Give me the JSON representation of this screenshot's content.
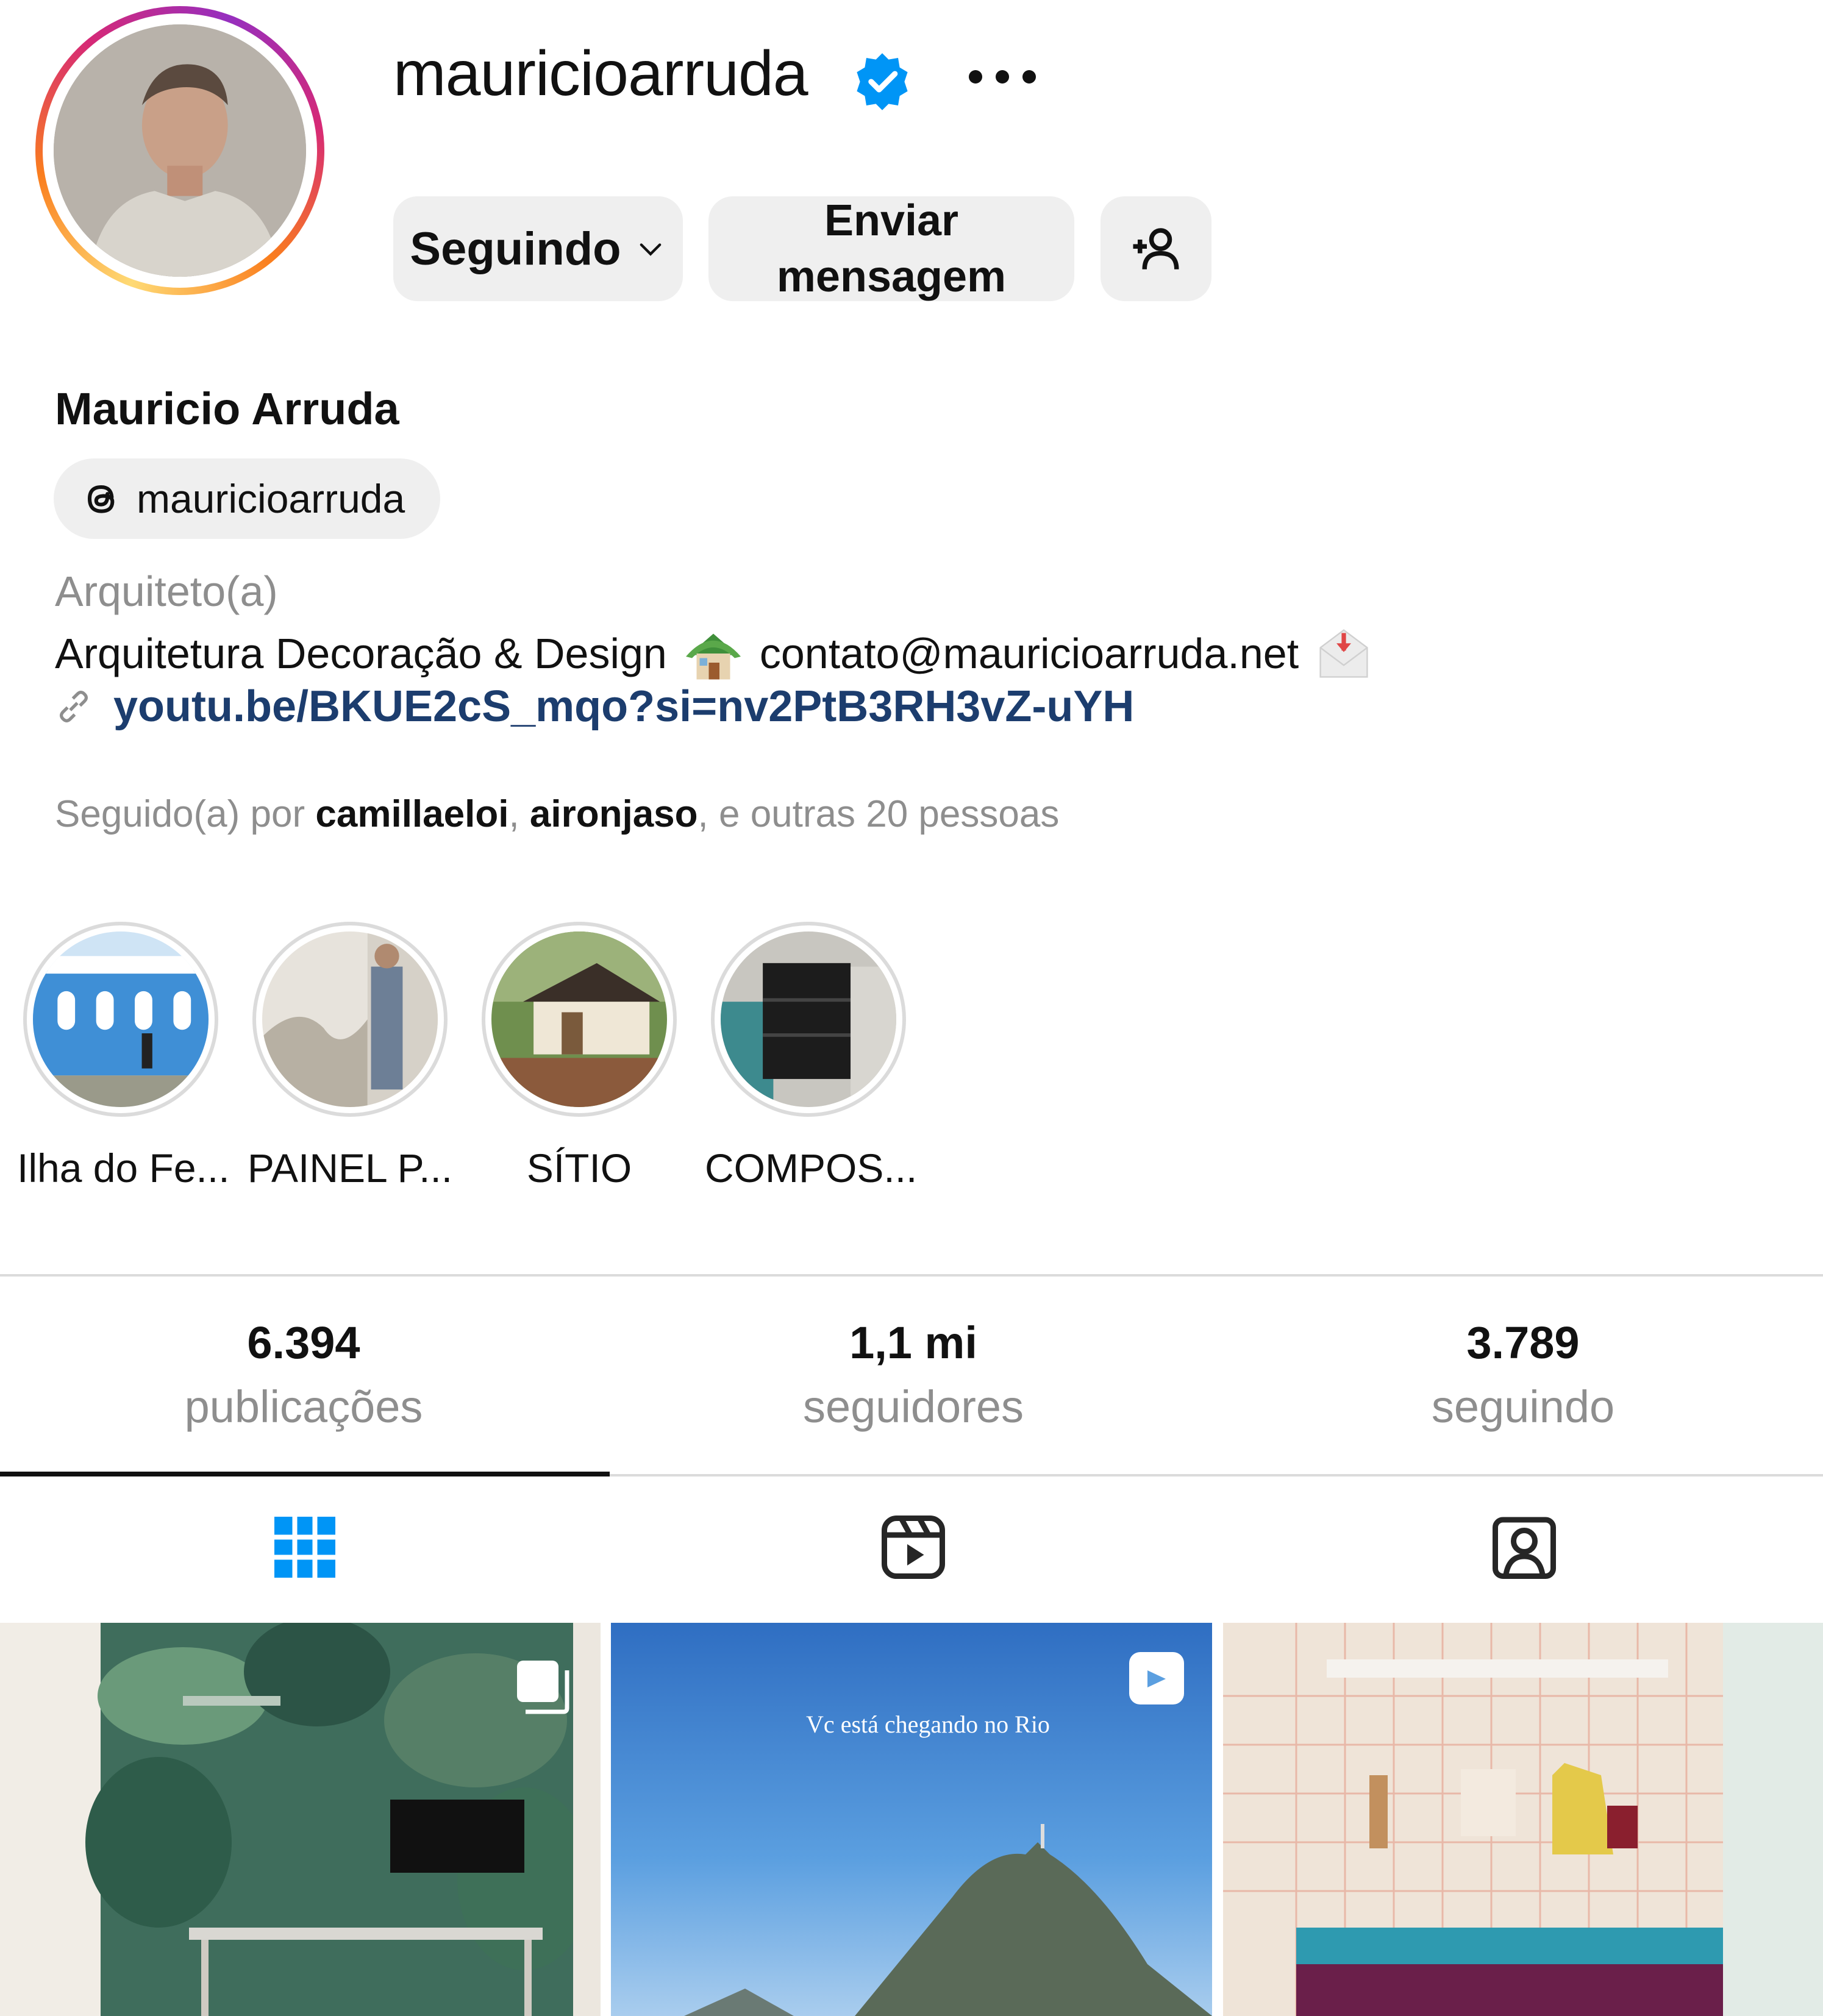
{
  "profile": {
    "username": "mauricioarruda",
    "full_name": "Mauricio Arruda",
    "threads_handle": "mauricioarruda",
    "category": "Arquiteto(a)",
    "bio_text": "Arquitetura Decoração & Design",
    "bio_email": "contato@mauricioarruda.net",
    "link": "youtu.be/BKUE2cS_mqo?si=nv2PtB3RH3vZ-uYH",
    "followed_prefix": "Seguido(a) por ",
    "followed_user_1": "camillaeloi",
    "followed_sep": ", ",
    "followed_user_2": "aironjaso",
    "followed_suffix": ", e outras 20 pessoas"
  },
  "actions": {
    "follow_label": "Seguindo",
    "message_line1": "Enviar",
    "message_line2": "mensagem"
  },
  "highlights": [
    {
      "label": "Ilha do Fe..."
    },
    {
      "label": "PAINEL P..."
    },
    {
      "label": "SÍTIO"
    },
    {
      "label": "COMPOS..."
    }
  ],
  "stats": [
    {
      "value": "6.394",
      "label": "publicações"
    },
    {
      "value": "1,1 mi",
      "label": "seguidores"
    },
    {
      "value": "3.789",
      "label": "seguindo"
    }
  ],
  "tabs": {
    "active": "posts",
    "items": [
      "posts-grid-icon",
      "reels-icon",
      "tagged-icon"
    ]
  },
  "posts": [
    {
      "overlay_icon": "carousel-icon"
    },
    {
      "overlay_icon": "reel-icon",
      "caption": "Vc está chegando no Rio"
    },
    {
      "overlay_icon": ""
    }
  ],
  "colors": {
    "verified": "#0095f6",
    "link": "#1c3d6e",
    "muted": "#8e8e8e",
    "button_bg": "#efefef",
    "active_tab_icon": "#0095f6"
  }
}
